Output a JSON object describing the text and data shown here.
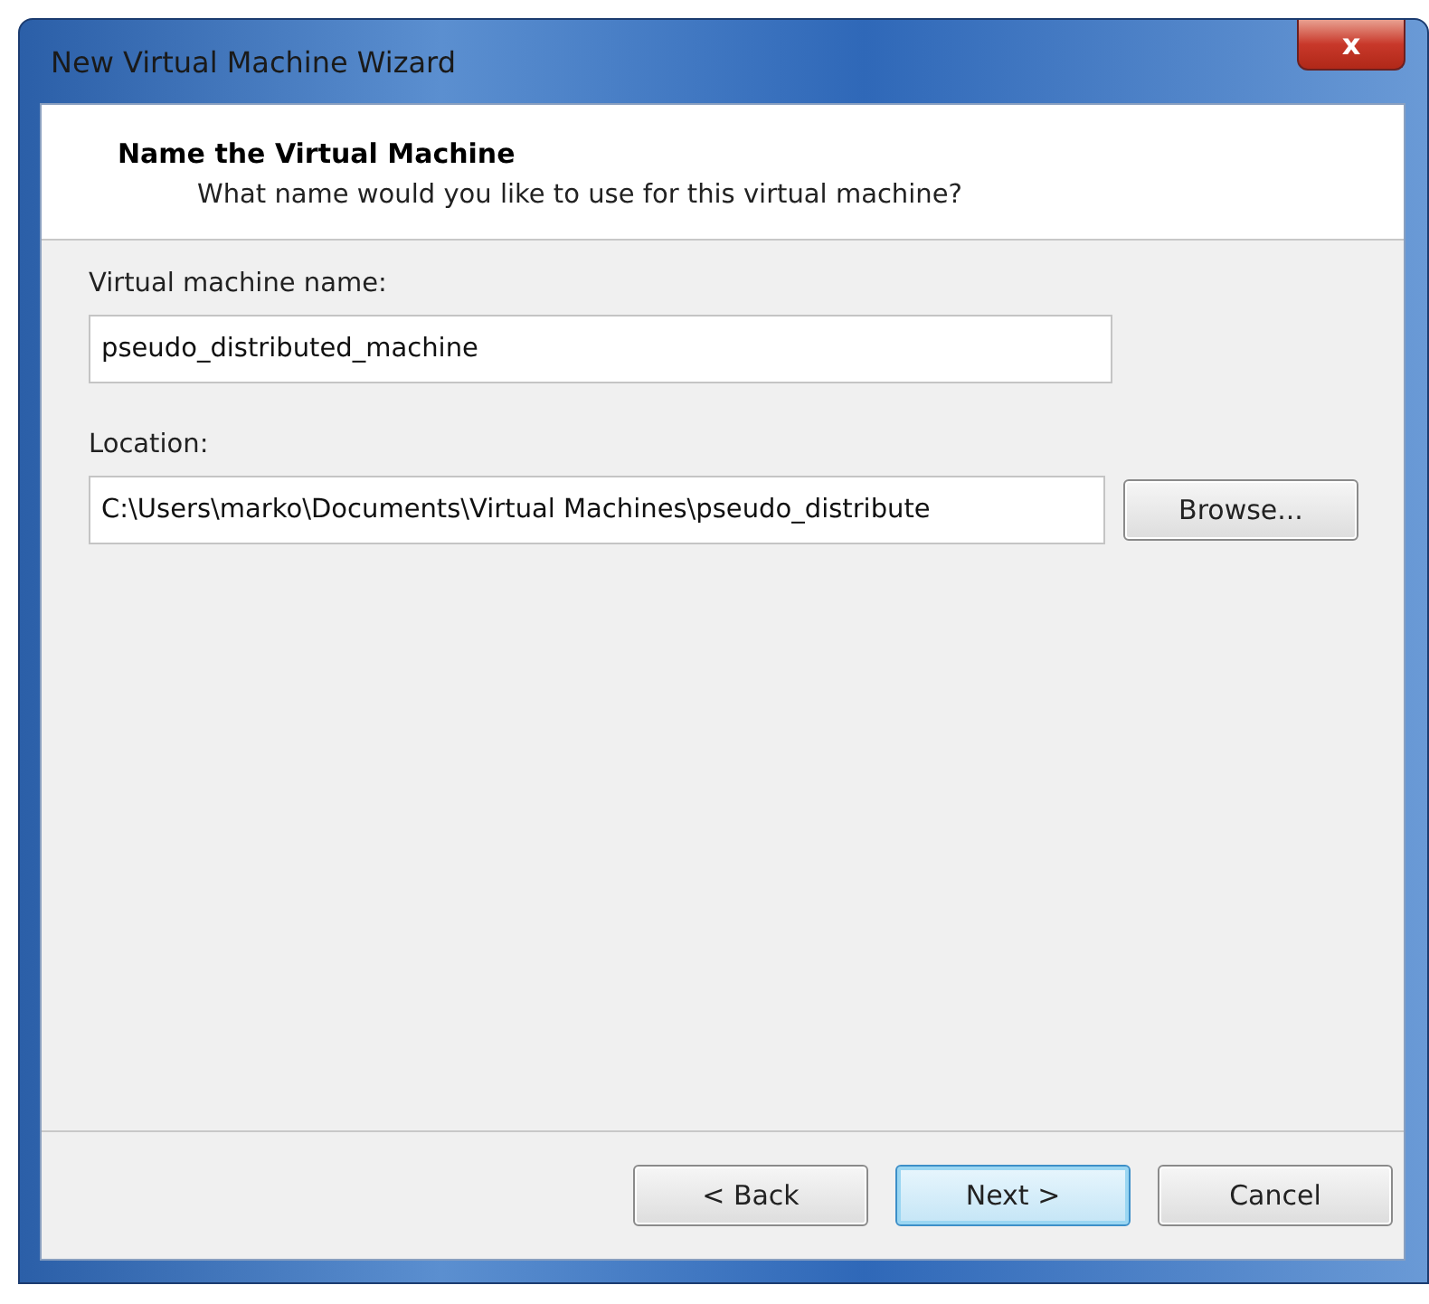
{
  "window": {
    "title": "New Virtual Machine Wizard",
    "close": "x"
  },
  "header": {
    "title": "Name the Virtual Machine",
    "subtitle": "What name would you like to use for this virtual machine?"
  },
  "fields": [
    {
      "label": "Virtual machine name:",
      "value": "pseudo_distributed_machine"
    },
    {
      "label": "Location:",
      "value": "C:\\Users\\marko\\Documents\\Virtual Machines\\pseudo_distribute",
      "button": "Browse..."
    }
  ],
  "buttons": [
    {
      "label": "< Back",
      "default": false
    },
    {
      "label": "Next >",
      "default": true
    },
    {
      "label": "Cancel",
      "default": false
    }
  ]
}
